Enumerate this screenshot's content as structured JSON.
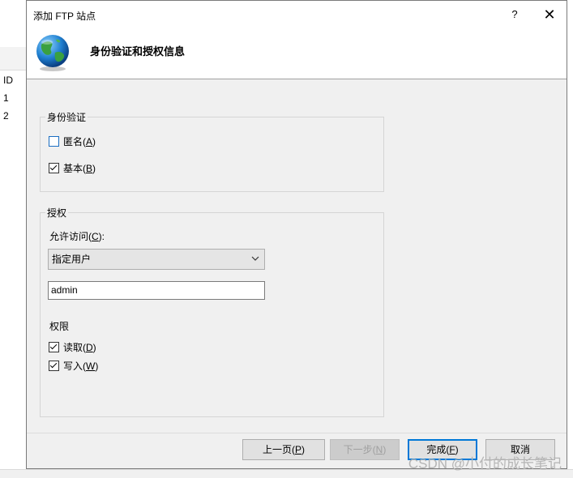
{
  "background": {
    "column_header": "ID",
    "rows": [
      "1",
      "2"
    ]
  },
  "dialog": {
    "title": "添加 FTP 站点",
    "help": "?",
    "close": "✕",
    "header_title": "身份验证和授权信息",
    "auth": {
      "legend": "身份验证",
      "anonymous": {
        "text": "匿名(",
        "key": "A",
        "tail": ")",
        "checked": false
      },
      "basic": {
        "text": "基本(",
        "key": "B",
        "tail": ")",
        "checked": true
      }
    },
    "authorization": {
      "legend": "授权",
      "allow_label": {
        "text": "允许访问(",
        "key": "C",
        "tail": "):"
      },
      "allow_select": "指定用户",
      "user_value": "admin",
      "permissions_label": "权限",
      "read": {
        "text": "读取(",
        "key": "D",
        "tail": ")",
        "checked": true
      },
      "write": {
        "text": "写入(",
        "key": "W",
        "tail": ")",
        "checked": true
      }
    },
    "buttons": {
      "prev": {
        "text": "上一页(",
        "key": "P",
        "tail": ")"
      },
      "next": {
        "text": "下一步(",
        "key": "N",
        "tail": ")"
      },
      "finish": {
        "text": "完成(",
        "key": "F",
        "tail": ")"
      },
      "cancel": "取消"
    }
  },
  "watermark": "CSDN @小付的成长笔记",
  "colors": {
    "accent": "#0078d7",
    "dialog_bg": "#f0f0f0"
  }
}
